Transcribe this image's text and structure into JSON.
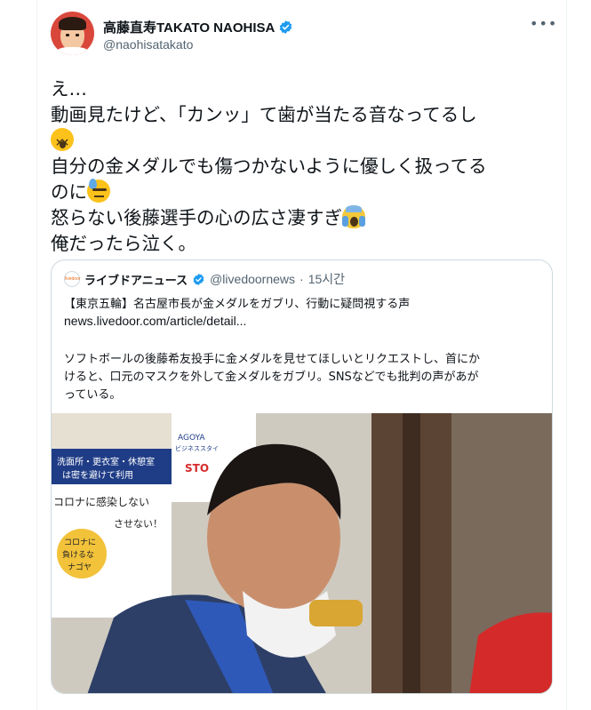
{
  "author": {
    "display_name": "高藤直寿TAKATO NAOHISA",
    "handle": "@naohisatakato",
    "verified": true
  },
  "menu": {
    "more_label": "•••"
  },
  "tweet": {
    "lines": [
      "え…",
      "動画見たけど、「カンッ」て歯が当たる音なってるし",
      "",
      "自分の金メダルでも傷つかないように優しく扱ってる",
      "のに",
      "怒らない後藤選手の心の広さ凄すぎ",
      "俺だったら泣く。"
    ],
    "emojis": [
      "dizzy-face-icon",
      "sweat-icon",
      "scream-icon"
    ]
  },
  "quoted_tweet": {
    "avatar_text": "livedoor",
    "name": "ライブドアニュース",
    "handle": "@livedoornews",
    "separator": "·",
    "time": "15시간",
    "verified": true,
    "title": "【東京五輪】名古屋市長が金メダルをガブリ、行動に疑問視する声",
    "link": "news.livedoor.com/article/detail...",
    "body_lines": [
      "ソフトボールの後藤希友投手に金メダルを見せてほしいとリクエストし、首にか",
      "けると、口元のマスクを外して金メダルをガブリ。SNSなどでも批判の声があが",
      "っている。"
    ],
    "photo": {
      "signs": [
        "洗面所・更衣室・休憩室",
        "は密を避けて利用",
        "コロナに感染しない",
        "させない！",
        "コロナに",
        "負けるな",
        "ナゴヤ",
        "AGOYA",
        "ビジネススタイ",
        "STO"
      ]
    }
  },
  "colors": {
    "verified_blue": "#1d9bf0",
    "secondary_text": "#536471",
    "border": "#cfd9de"
  }
}
